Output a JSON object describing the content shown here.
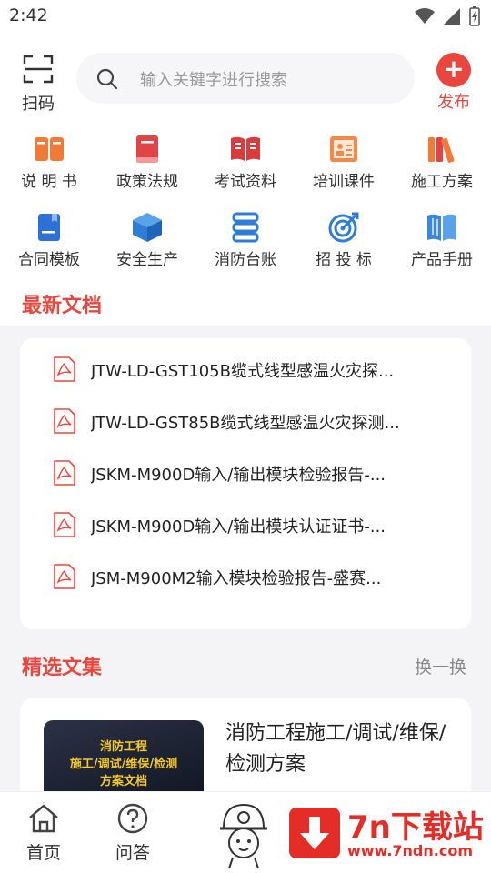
{
  "status": {
    "time": "2:42"
  },
  "header": {
    "scan_label": "扫码",
    "search_placeholder": "输入关键字进行搜索",
    "publish_label": "发布",
    "accent": "#e9463f"
  },
  "categories": [
    {
      "label": "说 明 书",
      "icon": "book-open-icon"
    },
    {
      "label": "政策法规",
      "icon": "red-book-icon"
    },
    {
      "label": "考试资料",
      "icon": "open-book-icon"
    },
    {
      "label": "培训课件",
      "icon": "presentation-icon"
    },
    {
      "label": "施工方案",
      "icon": "books-icon"
    },
    {
      "label": "合同模板",
      "icon": "document-icon"
    },
    {
      "label": "安全生产",
      "icon": "box-icon"
    },
    {
      "label": "消防台账",
      "icon": "ledger-icon"
    },
    {
      "label": "招 投 标",
      "icon": "target-icon"
    },
    {
      "label": "产品手册",
      "icon": "manual-icon"
    }
  ],
  "latest": {
    "title": "最新文档",
    "items": [
      "JTW-LD-GST105B缆式线型感温火灾探...",
      "JTW-LD-GST85B缆式线型感温火灾探测...",
      "JSKM-M900D输入/输出模块检验报告-...",
      "JSKM-M900D输入/输出模块认证证书-...",
      "JSM-M900M2输入模块检验报告-盛赛..."
    ]
  },
  "featured": {
    "title": "精选文集",
    "swap_label": "换一换",
    "cover_lines": [
      "消防工程",
      "施工/调试/维保/检测",
      "方案文档"
    ],
    "item_title": "消防工程施工/调试/维保/检测方案"
  },
  "nav": {
    "home": "首页",
    "qa": "问答"
  },
  "watermark": {
    "brand": "7n下载站",
    "url": "www.7ndn.com"
  }
}
